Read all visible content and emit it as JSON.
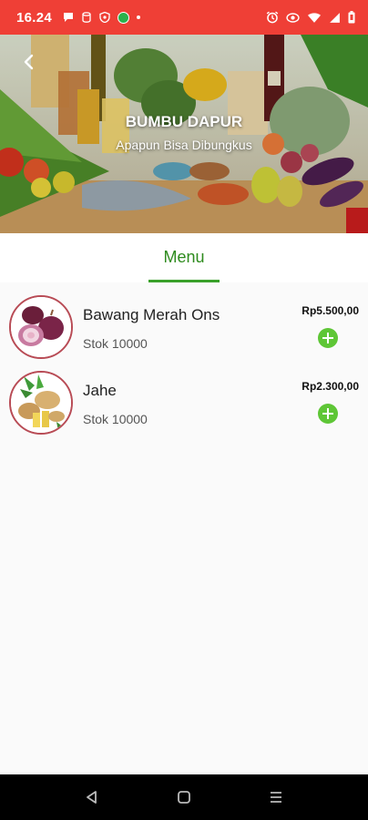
{
  "status_bar": {
    "time": "16.24",
    "left_icons": [
      "chat-icon",
      "database-icon",
      "shield-icon",
      "whatsapp-icon",
      "dot-icon"
    ],
    "right_icons": [
      "alarm-icon",
      "eye-icon",
      "wifi-icon",
      "signal-icon",
      "battery-icon"
    ]
  },
  "header": {
    "title": "BUMBU DAPUR",
    "subtitle": "Apapun Bisa Dibungkus"
  },
  "tabs": [
    {
      "label": "Menu",
      "active": true
    }
  ],
  "items": [
    {
      "name": "Bawang Merah Ons",
      "stock": "Stok 10000",
      "price": "Rp5.500,00",
      "image": "shallot"
    },
    {
      "name": "Jahe",
      "stock": "Stok 10000",
      "price": "Rp2.300,00",
      "image": "ginger"
    }
  ],
  "colors": {
    "status_bar": "#ef3f36",
    "accent_green": "#3aa12a",
    "add_button": "#5ec636",
    "thumb_border": "#b84b55"
  },
  "nav_bar": {
    "buttons": [
      "back-icon",
      "home-icon",
      "recents-icon"
    ]
  }
}
